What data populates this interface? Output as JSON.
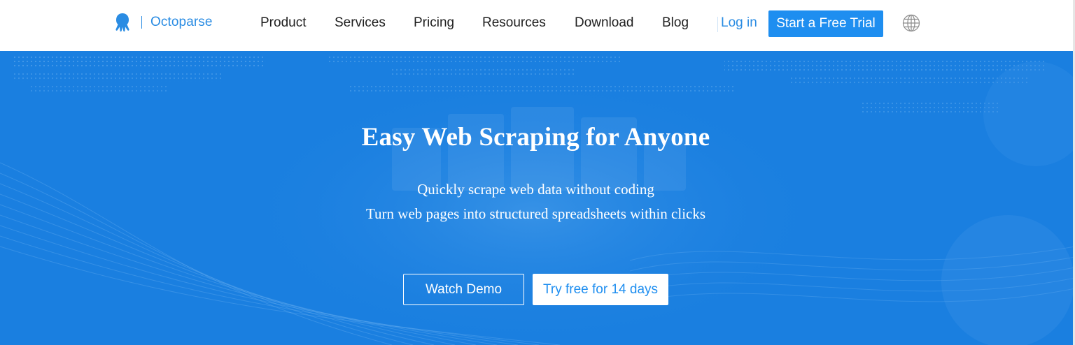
{
  "brand": {
    "name": "Octoparse",
    "icon": "octopus-logo-icon",
    "color": "#2a8ce3"
  },
  "nav": {
    "items": [
      {
        "label": "Product"
      },
      {
        "label": "Services"
      },
      {
        "label": "Pricing"
      },
      {
        "label": "Resources"
      },
      {
        "label": "Download"
      },
      {
        "label": "Blog"
      }
    ],
    "login": "Log in",
    "trial_cta": "Start a Free Trial",
    "language_icon": "globe-icon"
  },
  "hero": {
    "title": "Easy Web Scraping for Anyone",
    "subtitle_line1": "Quickly scrape web data without coding",
    "subtitle_line2": "Turn web pages into structured spreadsheets within clicks",
    "demo_button": "Watch Demo",
    "try_button": "Try free for 14 days",
    "background_color": "#1a7fe0",
    "accent_color": "#1e8ef0"
  }
}
